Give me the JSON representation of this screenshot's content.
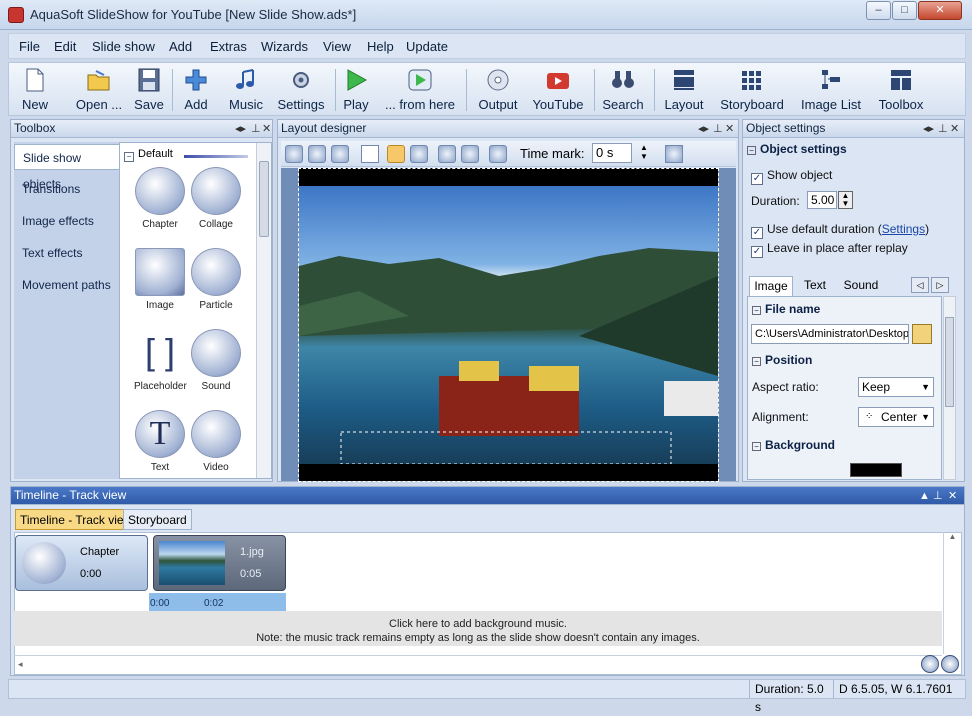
{
  "window": {
    "title": "AquaSoft SlideShow for YouTube [New Slide Show.ads*]",
    "min": "–",
    "max": "□",
    "close": "✕"
  },
  "menu": [
    "File",
    "Edit",
    "Slide show",
    "Add",
    "Extras",
    "Wizards",
    "View",
    "Help",
    "Update"
  ],
  "toolbar": {
    "new": "New",
    "open": "Open ...",
    "save": "Save",
    "add": "Add",
    "music": "Music",
    "settings": "Settings",
    "play": "Play",
    "from_here": "... from here",
    "output": "Output",
    "youtube": "YouTube",
    "search": "Search",
    "layout": "Layout",
    "storyboard": "Storyboard",
    "image_list": "Image List",
    "toolbox": "Toolbox"
  },
  "toolbox": {
    "title": "Toolbox",
    "tabs": [
      "Slide show objects",
      "Transitions",
      "Image effects",
      "Text effects",
      "Movement paths"
    ],
    "group": "Default",
    "items": [
      "Chapter",
      "Collage",
      "Image",
      "Particle",
      "Placeholder",
      "Sound",
      "Text",
      "Video"
    ]
  },
  "designer": {
    "title": "Layout designer",
    "time_mark_label": "Time mark:",
    "time_mark_value": "0 s"
  },
  "object_settings": {
    "title": "Object settings",
    "section": "Object settings",
    "show_object": "Show object",
    "duration_label": "Duration:",
    "duration_value": "5.00",
    "use_default_prefix": "Use default duration (",
    "settings_link": "Settings",
    "use_default_suffix": ")",
    "leave_in_place": "Leave in place after replay",
    "tabs": [
      "Image",
      "Text",
      "Sound"
    ],
    "file_name_section": "File name",
    "file_path": "C:\\Users\\Administrator\\Desktop",
    "position_section": "Position",
    "aspect_label": "Aspect ratio:",
    "aspect_value": "Keep",
    "alignment_label": "Alignment:",
    "alignment_value": "Center",
    "background_section": "Background"
  },
  "timeline": {
    "title": "Timeline - Track view",
    "tabs": [
      "Timeline - Track view",
      "Storyboard"
    ],
    "chapter_name": "Chapter",
    "chapter_time": "0:00",
    "image_name": "1.jpg",
    "image_time": "0:05",
    "ruler": [
      "0:00",
      "0:02"
    ],
    "music_line1": "Click here to add background music.",
    "music_line2": "Note: the music track remains empty as long as the slide show doesn't contain any images."
  },
  "status": {
    "duration": "Duration: 5.0 s",
    "version": "D 6.5.05, W 6.1.7601"
  }
}
